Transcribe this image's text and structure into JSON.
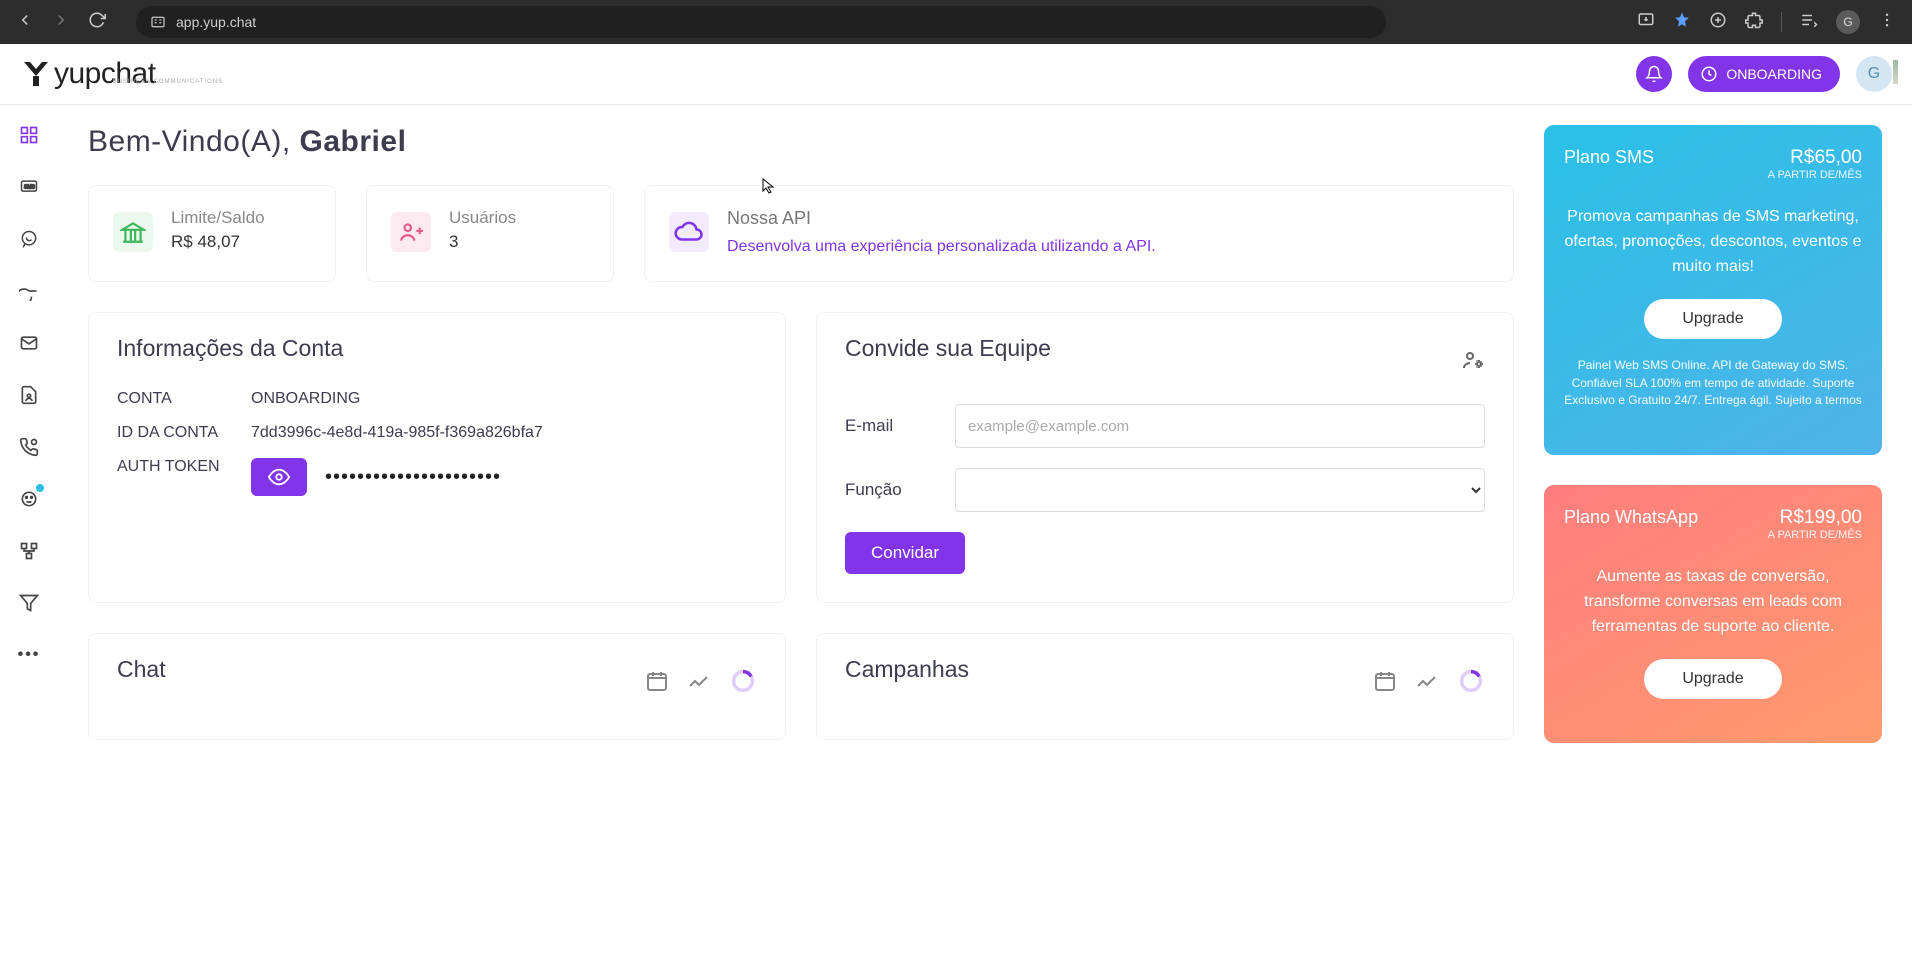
{
  "browser": {
    "url": "app.yup.chat",
    "avatar_letter": "G"
  },
  "header": {
    "onboarding": "ONBOARDING",
    "avatar_letter": "G"
  },
  "welcome": {
    "greeting": "Bem-Vindo(A), ",
    "name": "Gabriel"
  },
  "cards": {
    "balance": {
      "label": "Limite/Saldo",
      "value": "R$ 48,07"
    },
    "users": {
      "label": "Usuários",
      "value": "3"
    },
    "api": {
      "title": "Nossa API",
      "desc": "Desenvolva uma experiência personalizada utilizando a API."
    }
  },
  "account": {
    "title": "Informações da Conta",
    "k_account": "CONTA",
    "v_account": "ONBOARDING",
    "k_id": "ID DA CONTA",
    "v_id": "7dd3996c-4e8d-419a-985f-f369a826bfa7",
    "k_token": "AUTH TOKEN",
    "v_token": "••••••••••••••••••••••"
  },
  "invite": {
    "title": "Convide sua Equipe",
    "email_label": "E-mail",
    "email_placeholder": "example@example.com",
    "role_label": "Função",
    "btn": "Convidar"
  },
  "chat_section": {
    "title": "Chat"
  },
  "camp_section": {
    "title": "Campanhas"
  },
  "plans": {
    "sms": {
      "title": "Plano SMS",
      "price": "R$65,00",
      "sub": "A PARTIR DE/MÊS",
      "desc": "Promova campanhas de SMS marketing, ofertas, promoções, descontos, eventos e muito mais!",
      "btn": "Upgrade",
      "foot": "Painel Web SMS Online. API de Gateway do SMS. Confiável SLA 100% em tempo de atividade. Suporte Exclusivo e Gratuito 24/7. Entrega ágil. Sujeito a termos"
    },
    "wa": {
      "title": "Plano WhatsApp",
      "price": "R$199,00",
      "sub": "A PARTIR DE/MÊS",
      "desc": "Aumente as taxas de conversão, transforme conversas em leads com ferramentas de suporte ao cliente.",
      "btn": "Upgrade"
    }
  }
}
